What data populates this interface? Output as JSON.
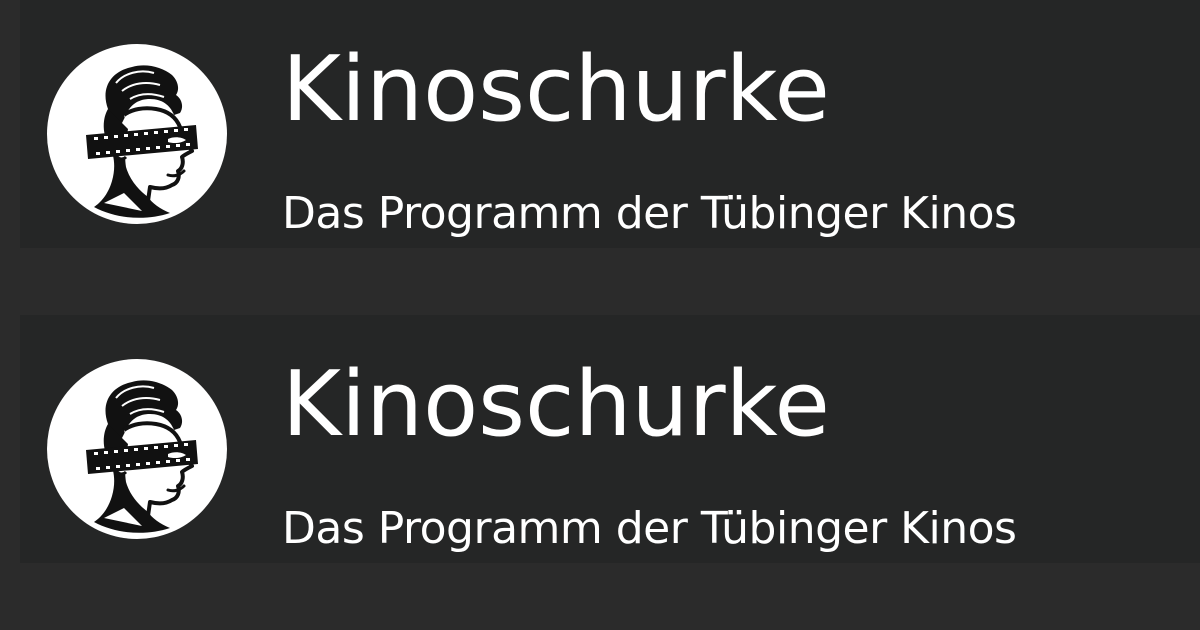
{
  "banners": [
    {
      "logo": "kinoschurke-logo",
      "title": "Kinoschurke",
      "subtitle": "Das Programm der Tübinger Kinos"
    },
    {
      "logo": "kinoschurke-logo",
      "title": "Kinoschurke",
      "subtitle": "Das Programm der Tübinger Kinos"
    }
  ],
  "colors": {
    "background": "#2b2b2b",
    "panel": "#252626",
    "text": "#ffffff",
    "logo_circle": "#ffffff",
    "logo_ink": "#111111"
  }
}
